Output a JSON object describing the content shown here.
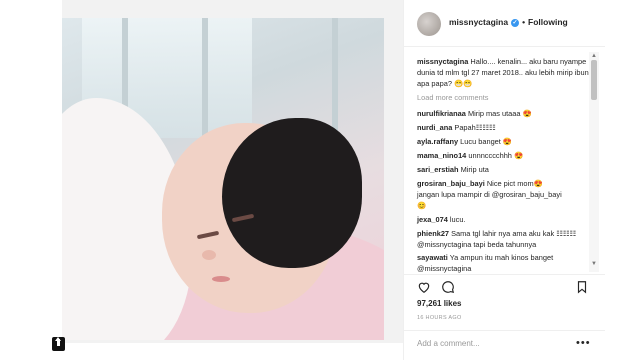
{
  "post": {
    "username": "missnyctagina",
    "follow_label": "Following",
    "caption_user": "missnyctagina",
    "caption_text": "Hallo.... kenalin... aku baru nyampe dunia td mlm tgl 27 maret 2018.. aku lebih mirip ibun apa papa? 😁😁",
    "load_more": "Load more comments",
    "likes": "97,261 likes",
    "time": "16 HOURS AGO",
    "add_comment_placeholder": "Add a comment..."
  },
  "comments": [
    {
      "user": "nurulfikrianaa",
      "text": "Mirip mas utaaa 😍"
    },
    {
      "user": "nurdi_ana",
      "text": "Papah☷☷☷"
    },
    {
      "user": "ayla.raffany",
      "text": "Lucu banget 😍"
    },
    {
      "user": "mama_nino14",
      "text": "unnncccchhh 😍"
    },
    {
      "user": "sari_erstiah",
      "text": "Mirip uta"
    },
    {
      "user": "grosiran_baju_bayi",
      "text": "Nice pict mom😍 jangan lupa mampir di @grosiran_baju_bayi 😊"
    },
    {
      "user": "jexa_074",
      "text": "lucu."
    },
    {
      "user": "phienk27",
      "text": "Sama tgl lahir nya ama aku kak ☷☷☷ @missnyctagina tapi beda tahunnya"
    },
    {
      "user": "sayawati",
      "text": "Ya ampun itu mah kinos banget @missnyctagina"
    }
  ],
  "icons": {
    "verified": "verified-badge-icon",
    "like": "heart-icon",
    "comment": "comment-bubble-icon",
    "save": "bookmark-icon",
    "more": "more-options-icon",
    "share": "share-icon"
  },
  "colors": {
    "verified": "#3897f0",
    "text": "#262626",
    "muted": "#999999"
  }
}
